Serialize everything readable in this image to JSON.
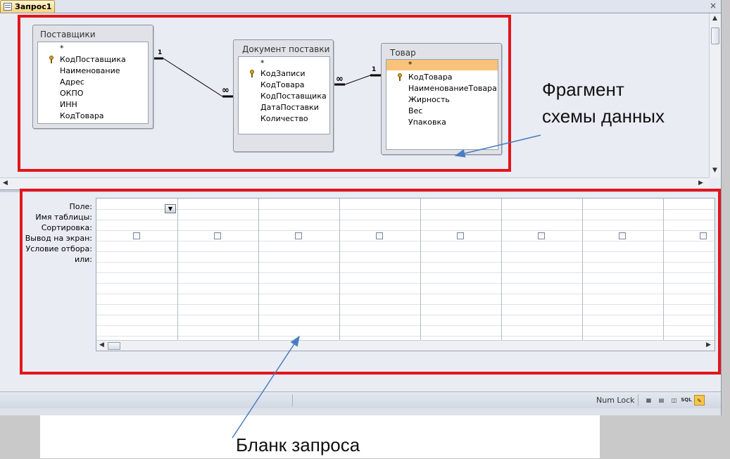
{
  "window": {
    "tab_title": "Запрос1",
    "close_glyph": "×"
  },
  "schema": {
    "tables": [
      {
        "id": "suppliers",
        "title": "Поставщики",
        "fields": [
          {
            "name": "*",
            "key": false
          },
          {
            "name": "КодПоставщика",
            "key": true
          },
          {
            "name": "Наименование",
            "key": false
          },
          {
            "name": "Адрес",
            "key": false
          },
          {
            "name": "ОКПО",
            "key": false
          },
          {
            "name": "ИНН",
            "key": false
          },
          {
            "name": "КодТовара",
            "key": false
          }
        ]
      },
      {
        "id": "delivery-doc",
        "title": "Документ поставки",
        "fields": [
          {
            "name": "*",
            "key": false
          },
          {
            "name": "КодЗаписи",
            "key": true
          },
          {
            "name": "КодТовара",
            "key": false
          },
          {
            "name": "КодПоставщика",
            "key": false
          },
          {
            "name": "ДатаПоставки",
            "key": false
          },
          {
            "name": "Количество",
            "key": false
          }
        ]
      },
      {
        "id": "goods",
        "title": "Товар",
        "fields": [
          {
            "name": "*",
            "key": false,
            "selected": true
          },
          {
            "name": "КодТовара",
            "key": true
          },
          {
            "name": "НаименованиеТовара",
            "key": false
          },
          {
            "name": "Жирность",
            "key": false
          },
          {
            "name": "Вес",
            "key": false
          },
          {
            "name": "Упаковка",
            "key": false
          }
        ]
      }
    ],
    "relations": [
      {
        "from": "Поставщики",
        "to": "Документ поставки",
        "from_label": "1",
        "to_label": "∞"
      },
      {
        "from": "Товар",
        "to": "Документ поставки",
        "from_label": "1",
        "to_label": "∞"
      }
    ]
  },
  "query_grid": {
    "row_labels": [
      "Поле:",
      "Имя таблицы:",
      "Сортировка:",
      "Вывод на экран:",
      "Условие отбора:",
      "или:"
    ],
    "column_count": 8,
    "dropdown_glyph": "▼"
  },
  "scroll_glyphs": {
    "up": "▲",
    "down": "▼",
    "left": "◀",
    "right": "▶"
  },
  "status_bar": {
    "num_lock": "Num Lock",
    "view_buttons": [
      {
        "icon": "datasheet-view-icon",
        "glyph": "▦"
      },
      {
        "icon": "pivot-table-view-icon",
        "glyph": "▤"
      },
      {
        "icon": "pivot-chart-view-icon",
        "glyph": "◫"
      },
      {
        "icon": "sql-view-icon",
        "glyph": "SQL"
      },
      {
        "icon": "design-view-icon",
        "glyph": "✎"
      }
    ]
  },
  "annotations": {
    "schema_caption_line1": "Фрагмент",
    "schema_caption_line2": "схемы данных",
    "grid_caption": "Бланк запроса"
  },
  "colors": {
    "highlight_box": "#e3151b",
    "arrow": "#4a7dc0",
    "selected_field": "#f9c27a",
    "active_view": "#f7c64a"
  }
}
